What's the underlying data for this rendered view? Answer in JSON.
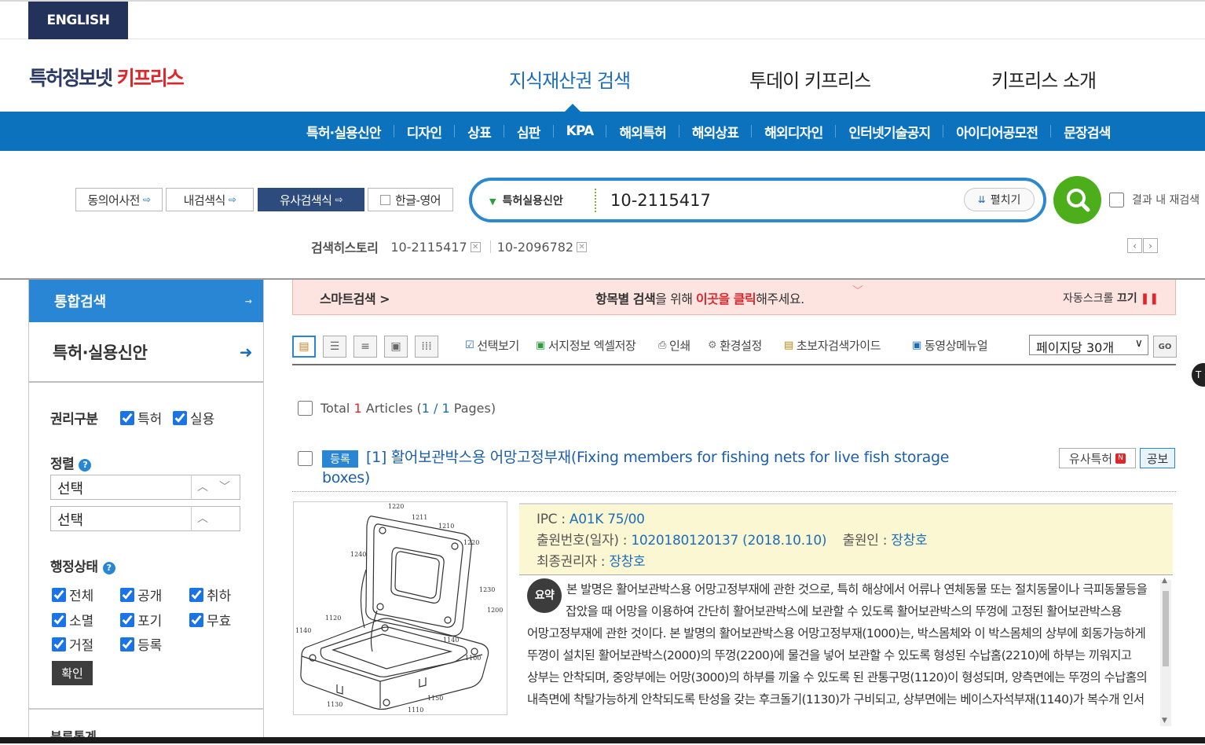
{
  "header": {
    "lang_button": "ENGLISH",
    "logo_part1": "특허정보넷",
    "logo_part2": "키프리스",
    "nav": [
      "지식재산권 검색",
      "투데이 키프리스",
      "키프리스 소개"
    ]
  },
  "subnav": [
    "특허·실용신안",
    "디자인",
    "상표",
    "심판",
    "KPA",
    "해외특허",
    "해외상표",
    "해외디자인",
    "인터넷기술공지",
    "아이디어공모전",
    "문장검색"
  ],
  "tools": {
    "synonym": "동의어사전",
    "my_color": "내검색식",
    "similar": "유사검색식",
    "lang_toggle": "한글-영어"
  },
  "search": {
    "category": "특허실용신안",
    "query": "10-2115417",
    "expand": "펼치기",
    "research_label": "결과 내 재검색"
  },
  "history": {
    "label": "검색히스토리",
    "items": [
      "10-2115417",
      "10-2096782"
    ]
  },
  "sidebar": {
    "head": "통합검색",
    "sub": "특허·실용신안",
    "rights_label": "권리구분",
    "rights": [
      "특허",
      "실용"
    ],
    "sort_label": "정렬",
    "sort1": "선택",
    "sort2": "선택",
    "status_label": "행정상태",
    "status": [
      "전체",
      "공개",
      "취하",
      "소멸",
      "포기",
      "무효",
      "거절",
      "등록"
    ],
    "confirm": "확인",
    "footer": "분류통계"
  },
  "smart": {
    "label": "스마트검색 >",
    "msg_a": "항목별 검색",
    "msg_b": "을 위해 ",
    "msg_c": "이곳을 클릭",
    "msg_d": "해주세요.",
    "auto": "자동스크롤",
    "off": "끄기"
  },
  "toolbar": {
    "opts": [
      "선택보기",
      "서지정보 엑셀저장",
      "인쇄",
      "환경설정",
      "초보자검색가이드",
      "동영상메뉴얼"
    ],
    "perpage": "페이지당 30개",
    "go": "GO"
  },
  "results": {
    "total_prefix": "Total",
    "total": "1",
    "articles": "Articles (",
    "page": "1 / 1",
    "pages_suffix": "Pages)"
  },
  "item": {
    "tag": "등록",
    "title": "[1] 활어보관박스용 어망고정부재(Fixing members for fishing nets for live fish storage boxes)",
    "similar_btn": "유사특허",
    "new_badge": "N",
    "pub_btn": "공보",
    "ipc_label": "IPC :",
    "ipc": "A01K 75/00",
    "appno_label": "출원번호(일자) :",
    "appno": "1020180120137 (2018.10.10)",
    "applicant_label": "출원인 :",
    "applicant": "장창호",
    "owner_label": "최종권리자 :",
    "owner": "장창호",
    "abstract_badge": "요약",
    "abstract": "본 발명은 활어보관박스용 어망고정부재에 관한 것으로, 특히 해상에서 어류나 연체동물 또는 절치동물이나 극피동물등을 잡았을 때 어망을 이용하여 간단히 활어보관박스에 보관할 수 있도록 활어보관박스의 뚜껑에 고정된 활어보관박스용 어망고정부재에 관한 것이다. 본 발명의 활어보관박스용 어망고정부재(1000)는, 박스몸체와 이 박스몸체의 상부에 회동가능하게 뚜껑이 설치된 활어보관박스(2000)의 뚜껑(2200)에 물건을 넣어 보관할 수 있도록 형성된 수납홈(2210)에 하부는 끼워지고 상부는 안착되며, 중앙부에는 어망(3000)의 하부를 끼울 수 있도록 된 관통구멍(1120)이 형성되며, 양측면에는 뚜껑의 수납홈의 내측면에 착탈가능하게 안착되도록 탄성을 갖는 후크돌기(1130)가 구비되고, 상부면에는 베이스자석부재(1140)가 복수개 인서"
  },
  "drawing_labels": [
    "1220",
    "1211",
    "1210",
    "1220",
    "1240",
    "1230",
    "1200",
    "1120",
    "1140",
    "1140",
    "1100",
    "1150",
    "1130",
    "1110"
  ]
}
